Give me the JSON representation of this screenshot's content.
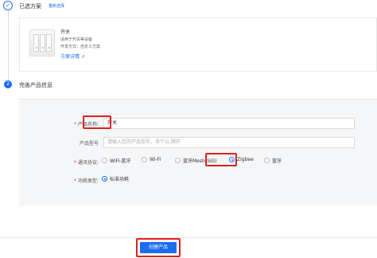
{
  "step1": {
    "number": "✓",
    "title": "已选方案",
    "reselect_link": "重新选择",
    "product": {
      "name": "开关",
      "desc": "适用于开关等设备",
      "dev_method": "开发方式：自定义方案",
      "details_link": "方案详情 ↗"
    }
  },
  "step2": {
    "number": "2",
    "title": "完善产品信息"
  },
  "form": {
    "product_name": {
      "label": "产品名称:",
      "value": "开关"
    },
    "product_model": {
      "label": "产品型号",
      "placeholder": "请输入您的产品型号，多个以,隔开"
    },
    "protocol": {
      "label": "通讯协议:",
      "options": [
        "WiFi-蓝牙",
        "Wi-Fi",
        "蓝牙Mesh(SIG)",
        "Zigbee",
        "蓝牙"
      ],
      "selected": "Zigbee"
    },
    "power_type": {
      "label": "功耗类型:",
      "options": [
        "标准功耗"
      ],
      "selected": "标准功耗"
    }
  },
  "footer": {
    "create_button": "创建产品"
  },
  "colors": {
    "accent": "#1a6cf0",
    "highlight": "#e02020"
  }
}
